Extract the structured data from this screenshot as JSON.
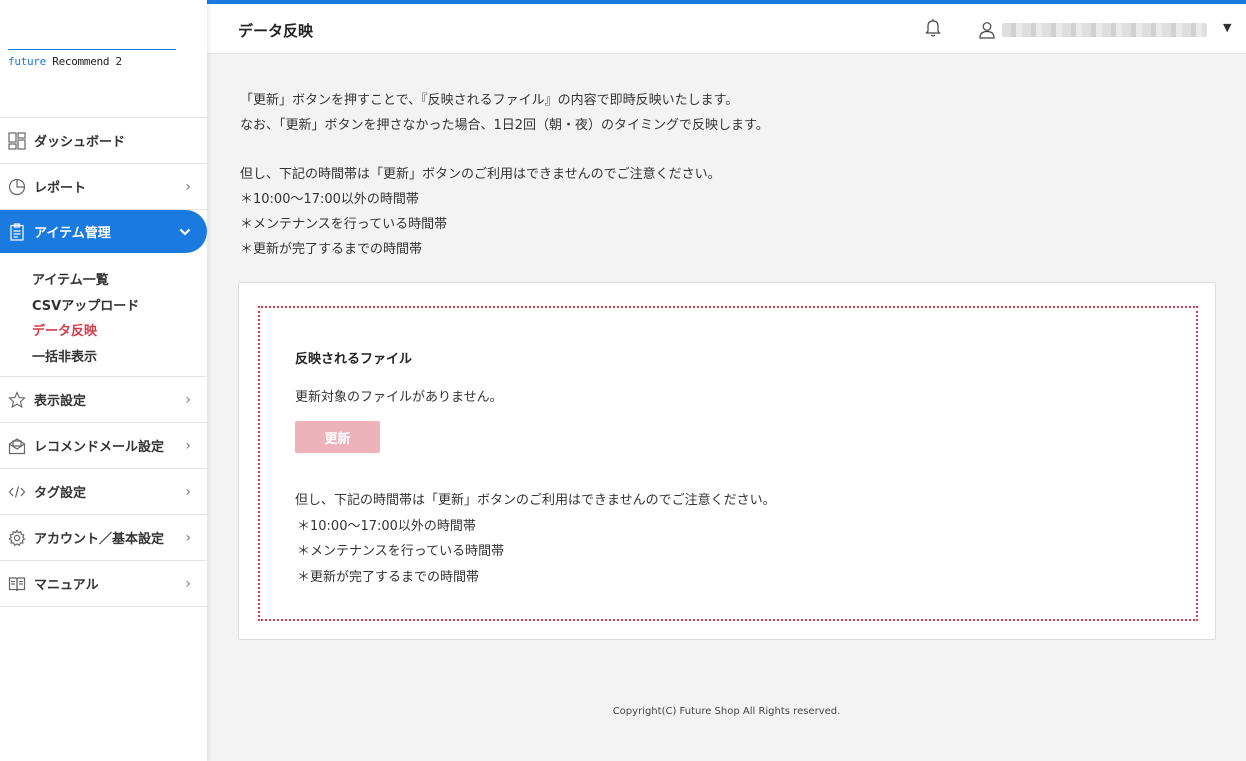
{
  "app": {
    "logo_brand": "future",
    "logo_rest": " Recommend 2"
  },
  "sidebar": {
    "items": [
      {
        "label": "ダッシュボード",
        "icon": "dashboard-icon"
      },
      {
        "label": "レポート",
        "icon": "pie-chart-icon"
      },
      {
        "label": "アイテム管理",
        "icon": "clipboard-icon"
      },
      {
        "label": "表示設定",
        "icon": "star-icon"
      },
      {
        "label": "レコメンドメール設定",
        "icon": "mail-icon"
      },
      {
        "label": "タグ設定",
        "icon": "code-icon"
      },
      {
        "label": "アカウント／基本設定",
        "icon": "gear-icon"
      },
      {
        "label": "マニュアル",
        "icon": "book-icon"
      }
    ],
    "sub_items": [
      {
        "label": "アイテム一覧"
      },
      {
        "label": "CSVアップロード"
      },
      {
        "label": "データ反映"
      },
      {
        "label": "一括非表示"
      }
    ]
  },
  "header": {
    "title": "データ反映"
  },
  "intro": {
    "line1": "「更新」ボタンを押すことで、『反映されるファイル』の内容で即時反映いたします。",
    "line2": "なお、「更新」ボタンを押さなかった場合、1日2回（朝・夜）のタイミングで反映します。",
    "line3": "但し、下記の時間帯は「更新」ボタンのご利用はできませんのでご注意ください。",
    "bullet1": "＊10:00～17:00以外の時間帯",
    "bullet2": "＊メンテナンスを行っている時間帯",
    "bullet3": "＊更新が完了するまでの時間帯"
  },
  "card": {
    "title": "反映されるファイル",
    "no_file": "更新対象のファイルがありません。",
    "update_label": "更新",
    "note": "但し、下記の時間帯は「更新」ボタンのご利用はできませんのでご注意ください。",
    "bullet1": "＊10:00～17:00以外の時間帯",
    "bullet2": "＊メンテナンスを行っている時間帯",
    "bullet3": "＊更新が完了するまでの時間帯"
  },
  "footer": {
    "copyright": "Copyright(C) Future Shop All Rights reserved."
  },
  "colors": {
    "accent": "#1a7ae0",
    "current_sub": "#d43a4a",
    "disabled_button": "#eeb3ba"
  }
}
